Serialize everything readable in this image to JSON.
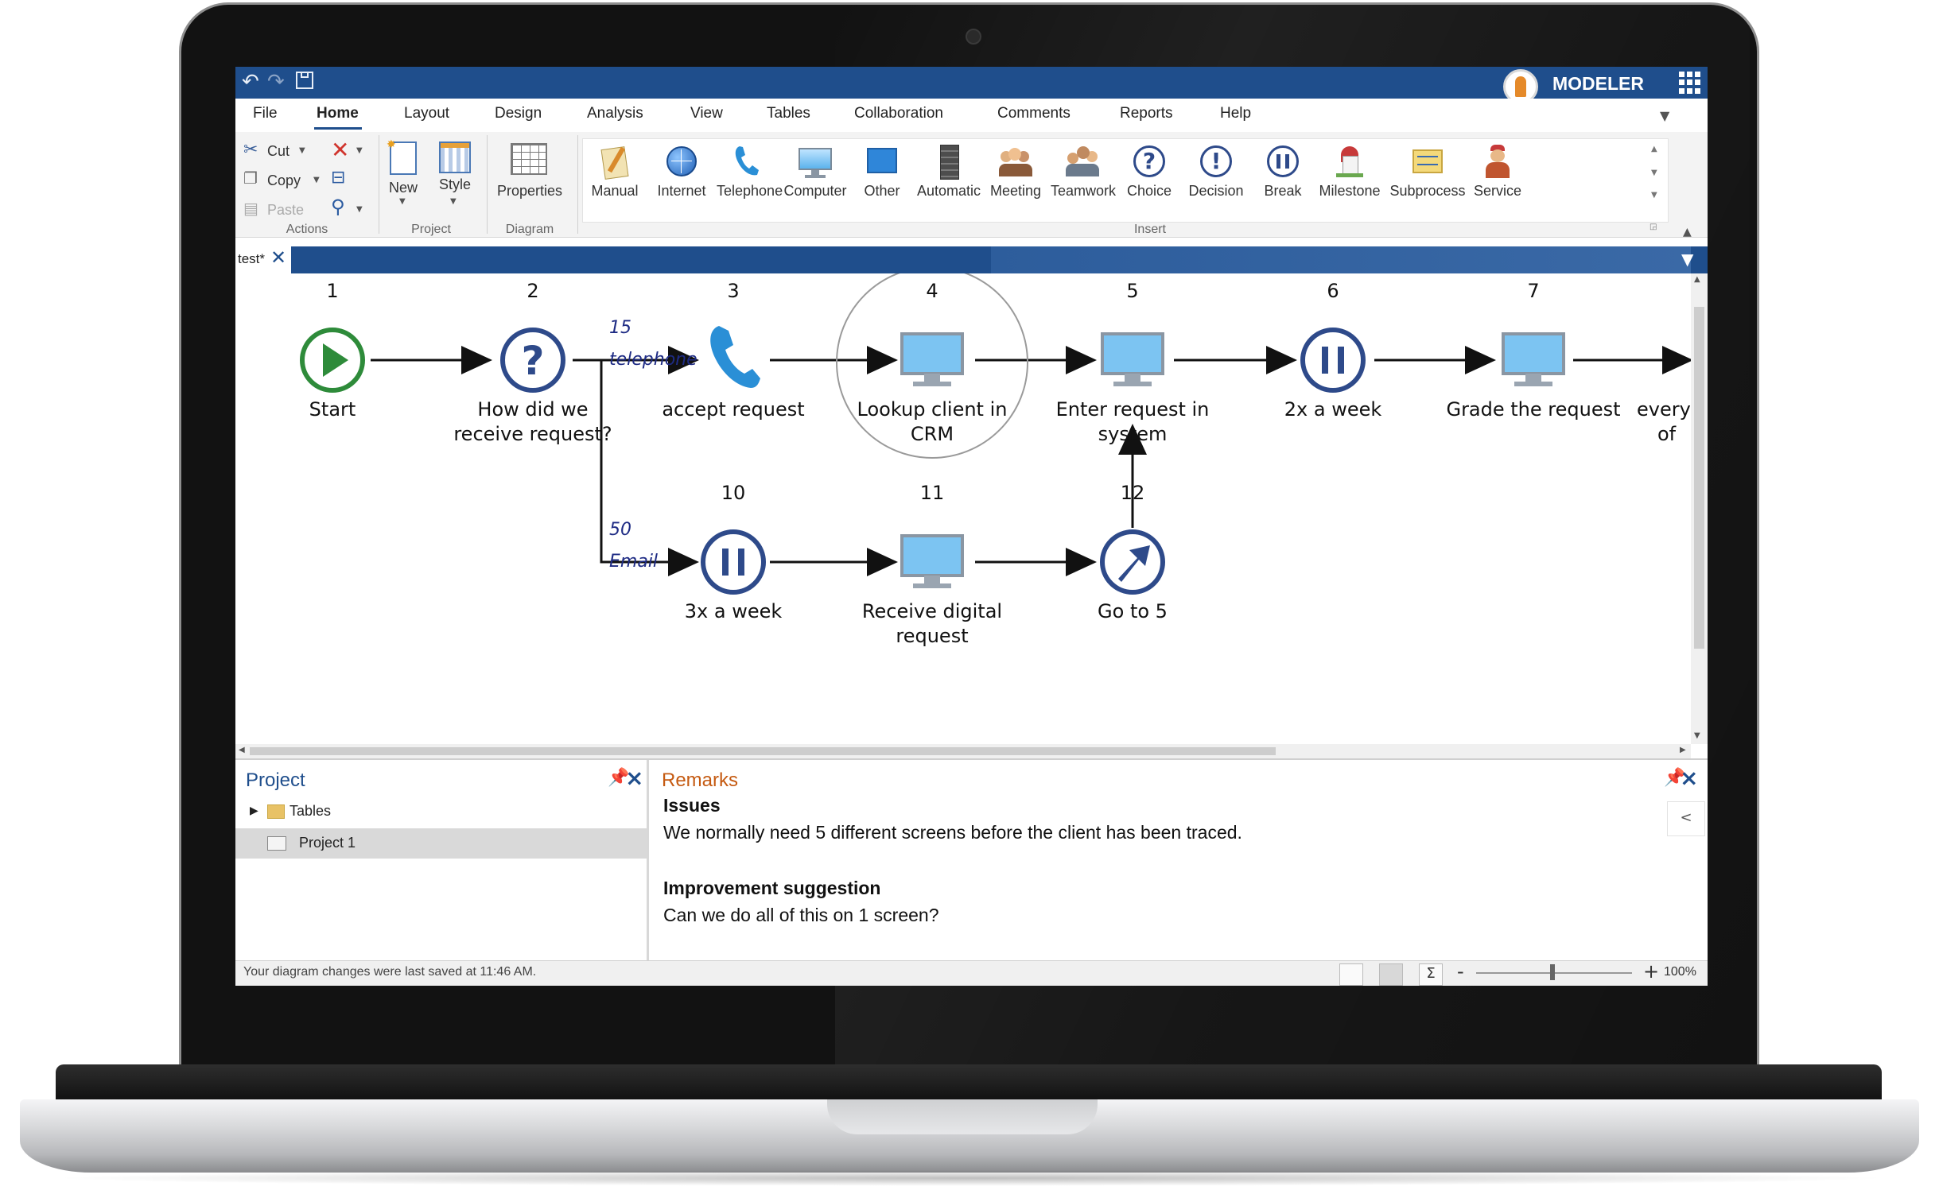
{
  "app": {
    "name": "MODELER",
    "quick_access": {
      "undo": "↶",
      "redo": "↷",
      "save": "💾"
    }
  },
  "menu": [
    "File",
    "Home",
    "Layout",
    "Design",
    "Analysis",
    "View",
    "Tables",
    "Collaboration",
    "Comments",
    "Reports",
    "Help"
  ],
  "ribbon": {
    "actions": {
      "cut": "Cut",
      "copy": "Copy",
      "paste": "Paste",
      "group": "Actions"
    },
    "project": {
      "new": "New",
      "style": "Style",
      "group": "Project"
    },
    "diagram": {
      "properties": "Properties",
      "group": "Diagram"
    },
    "insert": {
      "group": "Insert",
      "items": [
        "Manual",
        "Internet",
        "Telephone",
        "Computer",
        "Other",
        "Automatic",
        "Meeting",
        "Teamwork",
        "Choice",
        "Decision",
        "Break",
        "Milestone",
        "Subprocess",
        "Service"
      ]
    }
  },
  "document_tab": {
    "label": "test*"
  },
  "diagram": {
    "nodes": [
      {
        "num": "1",
        "label": "Start",
        "icon": "play-icon"
      },
      {
        "num": "2",
        "label_line1": "How did we",
        "label_line2": "receive request?",
        "icon": "question-icon"
      },
      {
        "num": "3",
        "label": "accept request",
        "icon": "telephone-icon"
      },
      {
        "num": "4",
        "label_line1": "Lookup client in",
        "label_line2": "CRM",
        "icon": "computer-icon"
      },
      {
        "num": "5",
        "label_line1": "Enter request in",
        "label_line2": "system",
        "icon": "computer-icon"
      },
      {
        "num": "6",
        "label": "2x a week",
        "icon": "pause-icon"
      },
      {
        "num": "7",
        "label": "Grade the request",
        "icon": "computer-icon"
      },
      {
        "num": "",
        "label_line1": "every",
        "label_line2": "of",
        "icon": ""
      },
      {
        "num": "10",
        "label": "3x a week",
        "icon": "pause-icon"
      },
      {
        "num": "11",
        "label_line1": "Receive digital",
        "label_line2": "request",
        "icon": "computer-icon"
      },
      {
        "num": "12",
        "label": "Go to 5",
        "icon": "goto-arrow-icon"
      }
    ],
    "branches": [
      {
        "value": "15",
        "label": "telephone"
      },
      {
        "value": "50",
        "label": "Email"
      }
    ]
  },
  "project_panel": {
    "title": "Project",
    "tree": [
      {
        "label": "Tables",
        "type": "folder"
      },
      {
        "label": "Project 1",
        "type": "project"
      }
    ]
  },
  "remarks_panel": {
    "title": "Remarks",
    "collapse": "<",
    "sections": [
      {
        "heading": "Issues",
        "text": "We normally need 5 different screens before the client has been traced."
      },
      {
        "heading": "Improvement suggestion",
        "text": "Can we do all of this on 1 screen?"
      }
    ]
  },
  "status": {
    "text": "Your diagram changes were last saved at 11:46 AM.",
    "zoom": "100%",
    "zoom_minus": "-",
    "zoom_plus": "+"
  },
  "colors": {
    "title_bar": "#1f4e8c",
    "accent_orange": "#c55a11",
    "node_blue": "#2e4a8a",
    "start_green": "#2e8b3a"
  }
}
